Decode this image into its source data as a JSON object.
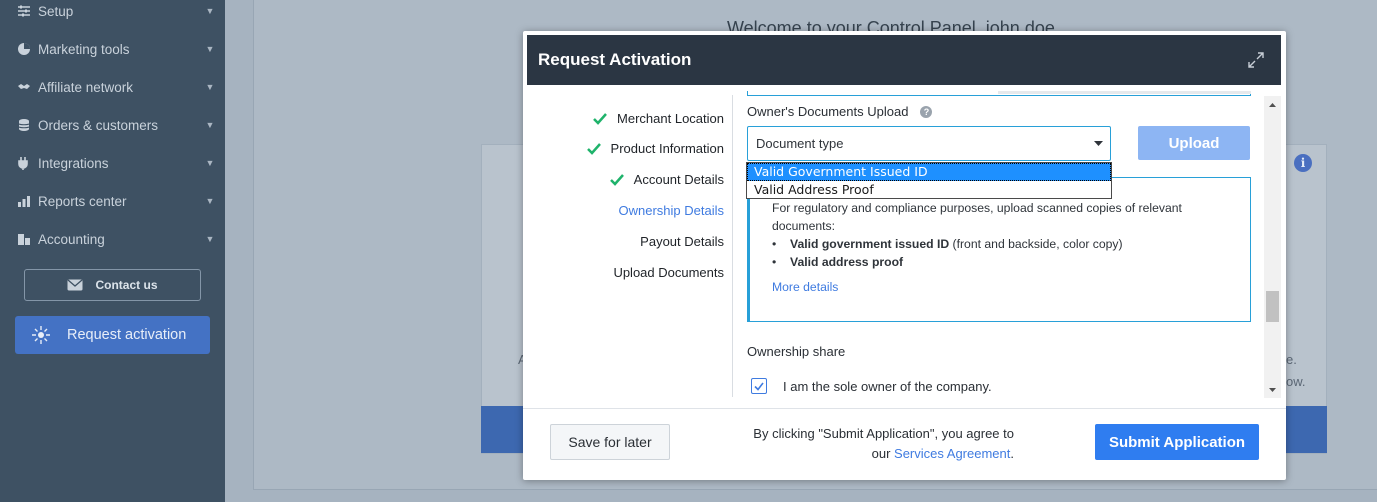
{
  "sidebar": {
    "items": [
      {
        "label": "Setup",
        "icon": "sliders-icon"
      },
      {
        "label": "Marketing tools",
        "icon": "pie-chart-icon"
      },
      {
        "label": "Affiliate network",
        "icon": "handshake-icon"
      },
      {
        "label": "Orders & customers",
        "icon": "database-icon"
      },
      {
        "label": "Integrations",
        "icon": "plug-icon"
      },
      {
        "label": "Reports center",
        "icon": "bar-chart-icon"
      },
      {
        "label": "Accounting",
        "icon": "building-icon"
      }
    ],
    "contact_label": "Contact us",
    "request_label": "Request activation"
  },
  "background": {
    "welcome": "Welcome to your Control Panel, john doe",
    "txt1": "e.",
    "txt2": "ow.",
    "txt3": "A"
  },
  "modal": {
    "title": "Request Activation",
    "steps": [
      {
        "label": "Merchant Location",
        "status": "done"
      },
      {
        "label": "Product Information",
        "status": "done"
      },
      {
        "label": "Account Details",
        "status": "done"
      },
      {
        "label": "Ownership Details",
        "status": "active"
      },
      {
        "label": "Payout Details",
        "status": "pending"
      },
      {
        "label": "Upload Documents",
        "status": "pending"
      }
    ],
    "documents_title": "Owner's Documents Upload",
    "help_symbol": "?",
    "doc_select_value": "Document type",
    "doc_options": [
      "Valid Government Issued ID",
      "Valid Address Proof"
    ],
    "upload_label": "Upload",
    "info_text": "For regulatory and compliance purposes, upload scanned copies of relevant documents:",
    "info_items": [
      {
        "bold": "Valid government issued ID",
        "rest": " (front and backside, color copy)"
      },
      {
        "bold": "Valid address proof",
        "rest": ""
      }
    ],
    "more_details": "More details",
    "ownership_title": "Ownership share",
    "sole_owner_label": "I am the sole owner of the company.",
    "sole_owner_checked": true
  },
  "footer": {
    "save_label": "Save for later",
    "agree_line1": "By clicking \"Submit Application\", you agree to",
    "agree_prefix": "our ",
    "agree_link": "Services Agreement",
    "agree_suffix": ".",
    "submit_label": "Submit Application"
  },
  "colors": {
    "accent": "#2f7df0",
    "check": "#1fb36b",
    "header": "#2b3643",
    "sidebar": "#3e5163"
  }
}
